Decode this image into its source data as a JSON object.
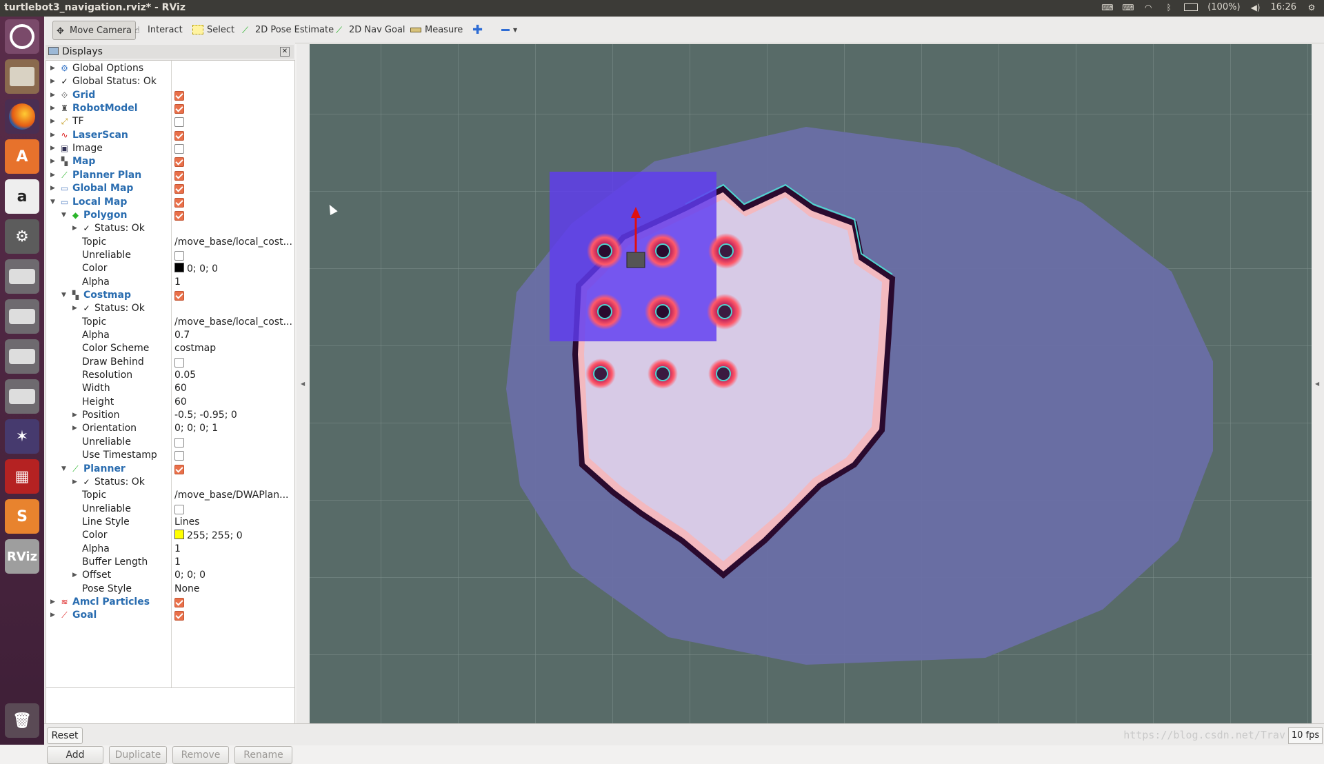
{
  "window": {
    "title": "turtlebot3_navigation.rviz* - RViz"
  },
  "tray": {
    "battery": "(100%)",
    "clock": "16:26"
  },
  "toolbar": {
    "move_camera": "Move Camera",
    "interact": "Interact",
    "select": "Select",
    "pose_estimate": "2D Pose Estimate",
    "nav_goal": "2D Nav Goal",
    "measure": "Measure"
  },
  "panel": {
    "title": "Displays",
    "rows": [
      {
        "name": "Global Options",
        "level": 0,
        "arrow": "right",
        "icon": "gear-icon",
        "style": "normal"
      },
      {
        "name": "Global Status: Ok",
        "level": 0,
        "arrow": "right",
        "icon": "check-icon",
        "style": "normal"
      },
      {
        "name": "Grid",
        "level": 0,
        "arrow": "right",
        "icon": "grid-icon",
        "style": "blue",
        "checked": true
      },
      {
        "name": "RobotModel",
        "level": 0,
        "arrow": "right",
        "icon": "robot-icon",
        "style": "blue",
        "checked": true
      },
      {
        "name": "TF",
        "level": 0,
        "arrow": "right",
        "icon": "axes-icon",
        "style": "normal",
        "checked": false
      },
      {
        "name": "LaserScan",
        "level": 0,
        "arrow": "right",
        "icon": "laser-icon",
        "style": "blue",
        "checked": true
      },
      {
        "name": "Image",
        "level": 0,
        "arrow": "right",
        "icon": "image-icon",
        "style": "normal",
        "checked": false
      },
      {
        "name": "Map",
        "level": 0,
        "arrow": "right",
        "icon": "map-icon",
        "style": "blue",
        "checked": true
      },
      {
        "name": "Planner Plan",
        "level": 0,
        "arrow": "right",
        "icon": "path-icon",
        "style": "blue",
        "checked": true
      },
      {
        "name": "Global Map",
        "level": 0,
        "arrow": "right",
        "icon": "folder-icon",
        "style": "blue",
        "checked": true
      },
      {
        "name": "Local Map",
        "level": 0,
        "arrow": "down",
        "icon": "folder-icon",
        "style": "blue",
        "checked": true
      },
      {
        "name": "Polygon",
        "level": 1,
        "arrow": "down",
        "icon": "polygon-icon",
        "style": "blue",
        "checked": true
      },
      {
        "name": "Status: Ok",
        "level": 2,
        "arrow": "right",
        "icon": "check-icon",
        "style": "normal"
      },
      {
        "name": "Topic",
        "level": 2,
        "style": "normal",
        "value": "/move_base/local_cost..."
      },
      {
        "name": "Unreliable",
        "level": 2,
        "style": "normal",
        "checked": false
      },
      {
        "name": "Color",
        "level": 2,
        "style": "normal",
        "value": "0; 0; 0",
        "swatch": "#000000"
      },
      {
        "name": "Alpha",
        "level": 2,
        "style": "normal",
        "value": "1"
      },
      {
        "name": "Costmap",
        "level": 1,
        "arrow": "down",
        "icon": "map-icon",
        "style": "blue",
        "checked": true
      },
      {
        "name": "Status: Ok",
        "level": 2,
        "arrow": "right",
        "icon": "check-icon",
        "style": "normal"
      },
      {
        "name": "Topic",
        "level": 2,
        "style": "normal",
        "value": "/move_base/local_cost..."
      },
      {
        "name": "Alpha",
        "level": 2,
        "style": "normal",
        "value": "0.7"
      },
      {
        "name": "Color Scheme",
        "level": 2,
        "style": "normal",
        "value": "costmap"
      },
      {
        "name": "Draw Behind",
        "level": 2,
        "style": "normal",
        "checked": false
      },
      {
        "name": "Resolution",
        "level": 2,
        "style": "normal",
        "value": "0.05"
      },
      {
        "name": "Width",
        "level": 2,
        "style": "normal",
        "value": "60"
      },
      {
        "name": "Height",
        "level": 2,
        "style": "normal",
        "value": "60"
      },
      {
        "name": "Position",
        "level": 2,
        "arrow": "right",
        "style": "normal",
        "value": "-0.5; -0.95; 0"
      },
      {
        "name": "Orientation",
        "level": 2,
        "arrow": "right",
        "style": "normal",
        "value": "0; 0; 0; 1"
      },
      {
        "name": "Unreliable",
        "level": 2,
        "style": "normal",
        "checked": false
      },
      {
        "name": "Use Timestamp",
        "level": 2,
        "style": "normal",
        "checked": false
      },
      {
        "name": "Planner",
        "level": 1,
        "arrow": "down",
        "icon": "path-icon",
        "style": "blue",
        "checked": true
      },
      {
        "name": "Status: Ok",
        "level": 2,
        "arrow": "right",
        "icon": "check-icon",
        "style": "normal"
      },
      {
        "name": "Topic",
        "level": 2,
        "style": "normal",
        "value": "/move_base/DWAPlan..."
      },
      {
        "name": "Unreliable",
        "level": 2,
        "style": "normal",
        "checked": false
      },
      {
        "name": "Line Style",
        "level": 2,
        "style": "normal",
        "value": "Lines"
      },
      {
        "name": "Color",
        "level": 2,
        "style": "normal",
        "value": "255; 255; 0",
        "swatch": "#ffff00"
      },
      {
        "name": "Alpha",
        "level": 2,
        "style": "normal",
        "value": "1"
      },
      {
        "name": "Buffer Length",
        "level": 2,
        "style": "normal",
        "value": "1"
      },
      {
        "name": "Offset",
        "level": 2,
        "arrow": "right",
        "style": "normal",
        "value": "0; 0; 0"
      },
      {
        "name": "Pose Style",
        "level": 2,
        "style": "normal",
        "value": "None"
      },
      {
        "name": "Amcl Particles",
        "level": 0,
        "arrow": "right",
        "icon": "particles-icon",
        "style": "blue",
        "checked": true
      },
      {
        "name": "Goal",
        "level": 0,
        "arrow": "right",
        "icon": "goal-icon",
        "style": "blue",
        "checked": true
      }
    ],
    "buttons": {
      "add": "Add",
      "duplicate": "Duplicate",
      "remove": "Remove",
      "rename": "Rename"
    }
  },
  "status": {
    "reset": "Reset",
    "fps": "10 fps",
    "watermark": "https://blog.csdn.net/Trav"
  }
}
